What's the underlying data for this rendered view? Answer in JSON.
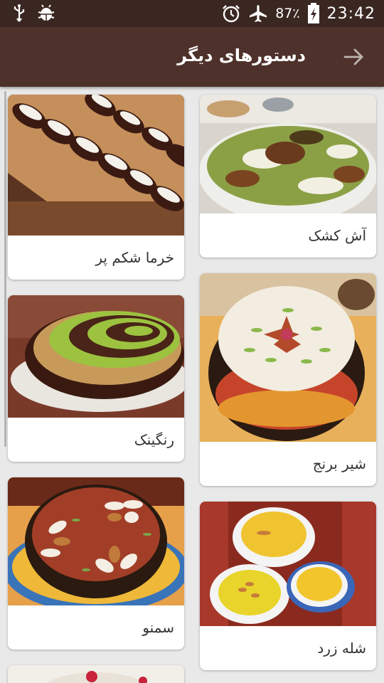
{
  "status_bar": {
    "time": "23:42",
    "battery": "87٪",
    "icons": [
      "usb-icon",
      "android-debug-icon",
      "alarm-icon",
      "airplane-icon",
      "battery-charging-icon"
    ]
  },
  "app_bar": {
    "title": "دستورهای دیگر",
    "back_icon": "arrow-right-icon"
  },
  "colors": {
    "status_bar": "#3a2722",
    "app_bar": "#4e312a",
    "background": "#e9e9e9",
    "card": "#ffffff"
  },
  "recipes": [
    {
      "title": "آش کشک",
      "image": "ash-kashk-photo"
    },
    {
      "title": "خرما شکم پر",
      "image": "stuffed-dates-photo"
    },
    {
      "title": "شیر برنج",
      "image": "rice-pudding-photo"
    },
    {
      "title": "رنگینک",
      "image": "ranginak-photo"
    },
    {
      "title": "شله زرد",
      "image": "sholeh-zard-photo"
    },
    {
      "title": "سمنو",
      "image": "samanu-photo"
    }
  ]
}
